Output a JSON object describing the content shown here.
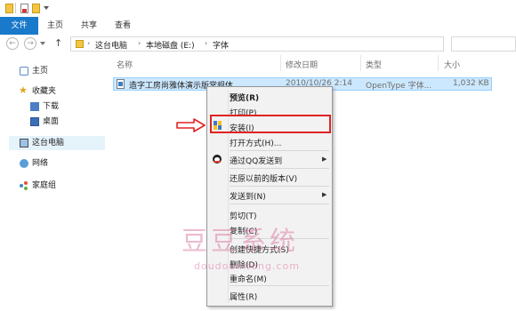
{
  "ribbon": {
    "tabs": [
      "文件",
      "主页",
      "共享",
      "查看"
    ],
    "active_tab": "文件",
    "accent": "#1979ca"
  },
  "address": {
    "crumbs": [
      "这台电脑",
      "本地磁盘 (E:)",
      "字体"
    ]
  },
  "nav": {
    "items": [
      "主页",
      "收藏夹",
      "下载",
      "桌面",
      "这台电脑",
      "网络",
      "家庭组"
    ],
    "selected": "这台电脑"
  },
  "columns": [
    "名称",
    "修改日期",
    "类型",
    "大小"
  ],
  "file": {
    "name": "造字工房尚雅体演示版常规体",
    "date": "2010/10/26 2:14",
    "type": "OpenType 字体...",
    "size": "1,032 KB"
  },
  "context_menu": {
    "items": [
      "预览(R)",
      "打印(P)",
      "安装(I)",
      "打开方式(H)...",
      "通过QQ发送到",
      "还原以前的版本(V)",
      "发送到(N)",
      "剪切(T)",
      "复制(C)",
      "创建快捷方式(S)",
      "删除(D)",
      "重命名(M)",
      "属性(R)"
    ],
    "highlighted": "安装(I)",
    "highlight_color": "#e02222"
  },
  "watermark": {
    "title": "豆豆系统",
    "url": "doudouxitong.com"
  }
}
